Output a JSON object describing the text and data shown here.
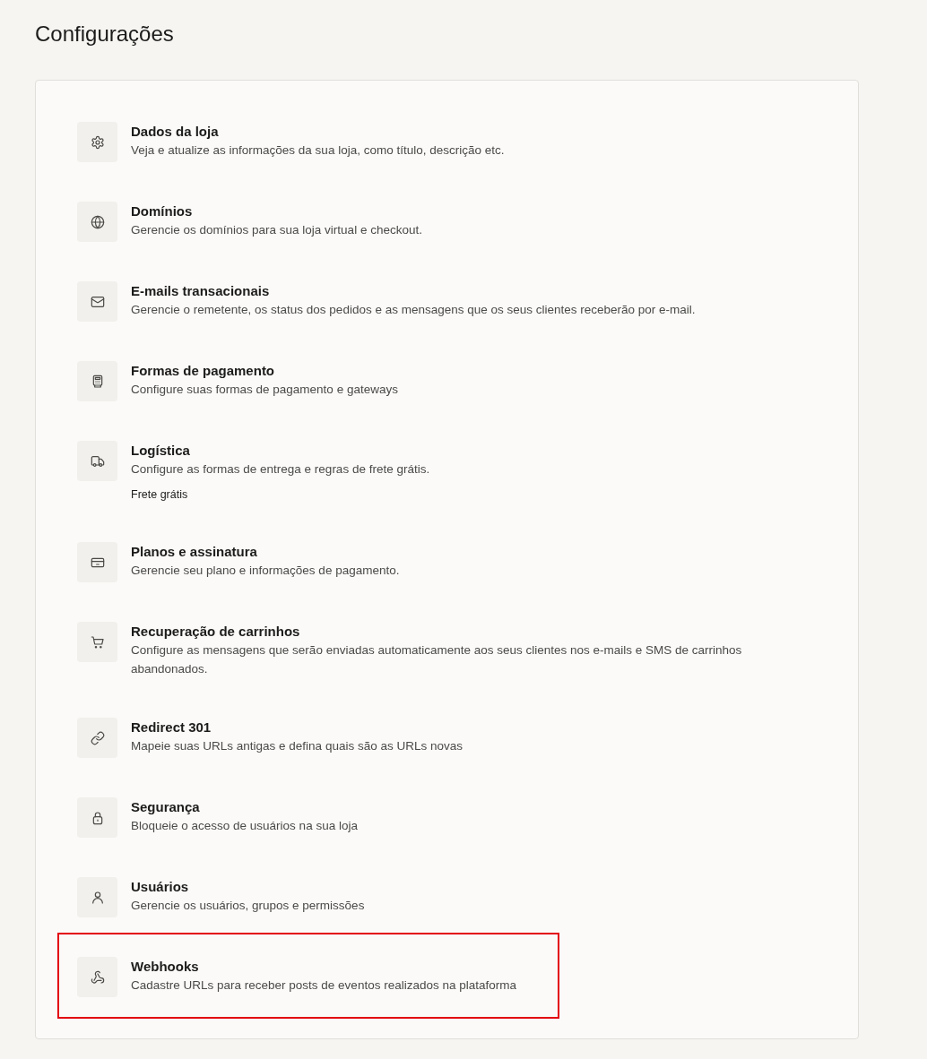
{
  "page": {
    "title": "Configurações"
  },
  "settings": [
    {
      "title": "Dados da loja",
      "description": "Veja e atualize as informações da sua loja, como título, descrição etc.",
      "highlighted": false
    },
    {
      "title": "Domínios",
      "description": "Gerencie os domínios para sua loja virtual e checkout.",
      "highlighted": false
    },
    {
      "title": "E-mails transacionais",
      "description": "Gerencie o remetente, os status dos pedidos e as mensagens que os seus clientes receberão por e-mail.",
      "highlighted": false
    },
    {
      "title": "Formas de pagamento",
      "description": "Configure suas formas de pagamento e gateways",
      "highlighted": false
    },
    {
      "title": "Logística",
      "description": "Configure as formas de entrega e regras de frete grátis.",
      "links": [
        "Frete grátis"
      ],
      "highlighted": false
    },
    {
      "title": "Planos e assinatura",
      "description": "Gerencie seu plano e informações de pagamento.",
      "highlighted": false
    },
    {
      "title": "Recuperação de carrinhos",
      "description": "Configure as mensagens que serão enviadas automaticamente aos seus clientes nos e-mails e SMS de carrinhos abandonados.",
      "highlighted": false
    },
    {
      "title": "Redirect 301",
      "description": "Mapeie suas URLs antigas e defina quais são as URLs novas",
      "highlighted": false
    },
    {
      "title": "Segurança",
      "description": "Bloqueie o acesso de usuários na sua loja",
      "highlighted": false
    },
    {
      "title": "Usuários",
      "description": "Gerencie os usuários, grupos e permissões",
      "highlighted": false
    },
    {
      "title": "Webhooks",
      "description": "Cadastre URLs para receber posts de eventos realizados na plataforma",
      "highlighted": true
    }
  ]
}
